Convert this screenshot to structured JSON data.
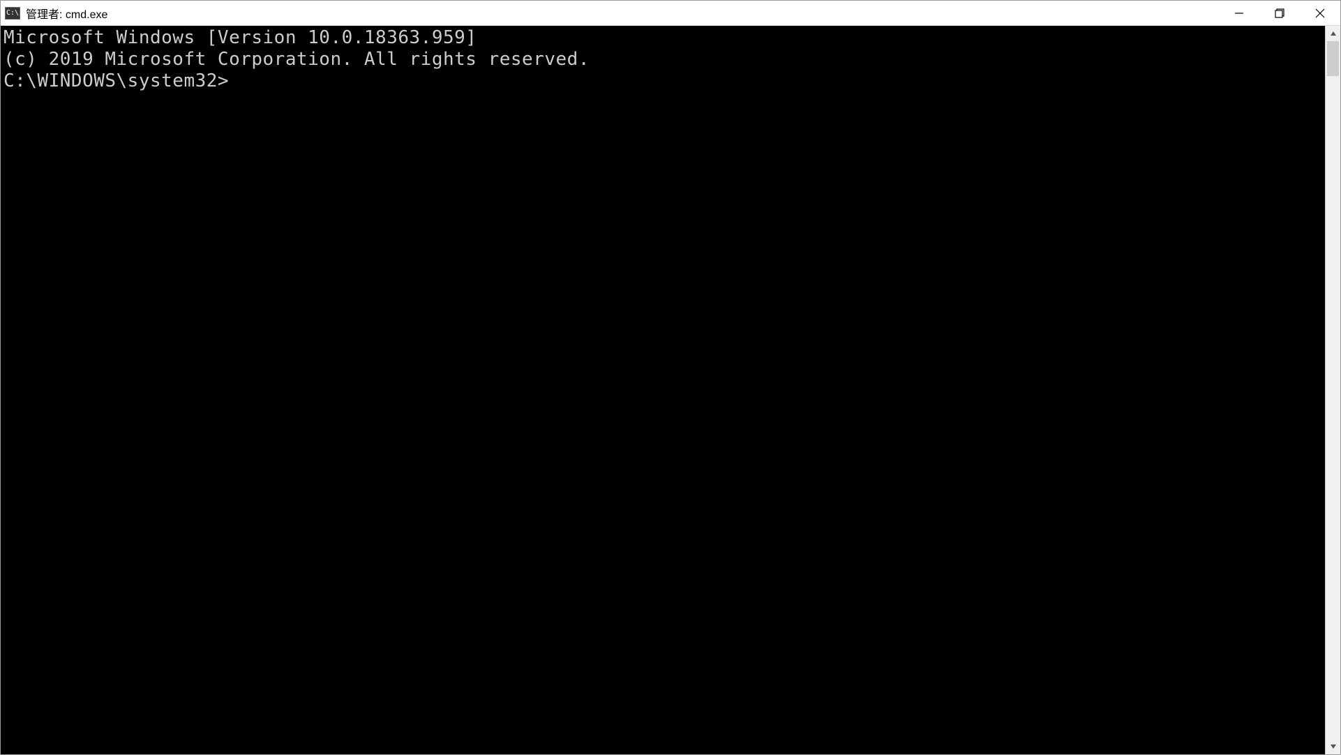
{
  "window": {
    "title": "管理者: cmd.exe",
    "app_icon_text": "C:\\"
  },
  "terminal": {
    "line1": "Microsoft Windows [Version 10.0.18363.959]",
    "line2": "(c) 2019 Microsoft Corporation. All rights reserved.",
    "blank": "",
    "prompt": "C:\\WINDOWS\\system32>"
  }
}
